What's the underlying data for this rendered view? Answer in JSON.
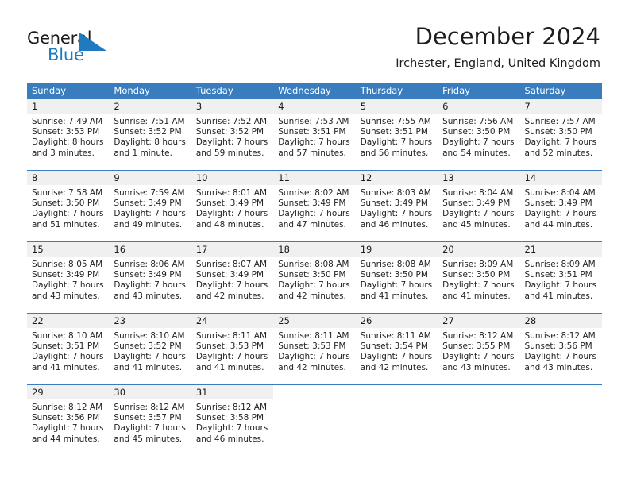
{
  "brand": {
    "name_part1": "General",
    "name_part2": "Blue",
    "triangle_color": "#1f7ac0"
  },
  "header": {
    "title": "December 2024",
    "location": "Irchester, England, United Kingdom"
  },
  "theme": {
    "header_blue": "#3a7dbf",
    "daynum_band": "#f0f0f0",
    "text": "#232323"
  },
  "calendar": {
    "weekday_headers": [
      "Sunday",
      "Monday",
      "Tuesday",
      "Wednesday",
      "Thursday",
      "Friday",
      "Saturday"
    ],
    "weeks": [
      [
        {
          "day": "1",
          "sunrise": "Sunrise: 7:49 AM",
          "sunset": "Sunset: 3:53 PM",
          "daylight1": "Daylight: 8 hours",
          "daylight2": "and 3 minutes."
        },
        {
          "day": "2",
          "sunrise": "Sunrise: 7:51 AM",
          "sunset": "Sunset: 3:52 PM",
          "daylight1": "Daylight: 8 hours",
          "daylight2": "and 1 minute."
        },
        {
          "day": "3",
          "sunrise": "Sunrise: 7:52 AM",
          "sunset": "Sunset: 3:52 PM",
          "daylight1": "Daylight: 7 hours",
          "daylight2": "and 59 minutes."
        },
        {
          "day": "4",
          "sunrise": "Sunrise: 7:53 AM",
          "sunset": "Sunset: 3:51 PM",
          "daylight1": "Daylight: 7 hours",
          "daylight2": "and 57 minutes."
        },
        {
          "day": "5",
          "sunrise": "Sunrise: 7:55 AM",
          "sunset": "Sunset: 3:51 PM",
          "daylight1": "Daylight: 7 hours",
          "daylight2": "and 56 minutes."
        },
        {
          "day": "6",
          "sunrise": "Sunrise: 7:56 AM",
          "sunset": "Sunset: 3:50 PM",
          "daylight1": "Daylight: 7 hours",
          "daylight2": "and 54 minutes."
        },
        {
          "day": "7",
          "sunrise": "Sunrise: 7:57 AM",
          "sunset": "Sunset: 3:50 PM",
          "daylight1": "Daylight: 7 hours",
          "daylight2": "and 52 minutes."
        }
      ],
      [
        {
          "day": "8",
          "sunrise": "Sunrise: 7:58 AM",
          "sunset": "Sunset: 3:50 PM",
          "daylight1": "Daylight: 7 hours",
          "daylight2": "and 51 minutes."
        },
        {
          "day": "9",
          "sunrise": "Sunrise: 7:59 AM",
          "sunset": "Sunset: 3:49 PM",
          "daylight1": "Daylight: 7 hours",
          "daylight2": "and 49 minutes."
        },
        {
          "day": "10",
          "sunrise": "Sunrise: 8:01 AM",
          "sunset": "Sunset: 3:49 PM",
          "daylight1": "Daylight: 7 hours",
          "daylight2": "and 48 minutes."
        },
        {
          "day": "11",
          "sunrise": "Sunrise: 8:02 AM",
          "sunset": "Sunset: 3:49 PM",
          "daylight1": "Daylight: 7 hours",
          "daylight2": "and 47 minutes."
        },
        {
          "day": "12",
          "sunrise": "Sunrise: 8:03 AM",
          "sunset": "Sunset: 3:49 PM",
          "daylight1": "Daylight: 7 hours",
          "daylight2": "and 46 minutes."
        },
        {
          "day": "13",
          "sunrise": "Sunrise: 8:04 AM",
          "sunset": "Sunset: 3:49 PM",
          "daylight1": "Daylight: 7 hours",
          "daylight2": "and 45 minutes."
        },
        {
          "day": "14",
          "sunrise": "Sunrise: 8:04 AM",
          "sunset": "Sunset: 3:49 PM",
          "daylight1": "Daylight: 7 hours",
          "daylight2": "and 44 minutes."
        }
      ],
      [
        {
          "day": "15",
          "sunrise": "Sunrise: 8:05 AM",
          "sunset": "Sunset: 3:49 PM",
          "daylight1": "Daylight: 7 hours",
          "daylight2": "and 43 minutes."
        },
        {
          "day": "16",
          "sunrise": "Sunrise: 8:06 AM",
          "sunset": "Sunset: 3:49 PM",
          "daylight1": "Daylight: 7 hours",
          "daylight2": "and 43 minutes."
        },
        {
          "day": "17",
          "sunrise": "Sunrise: 8:07 AM",
          "sunset": "Sunset: 3:49 PM",
          "daylight1": "Daylight: 7 hours",
          "daylight2": "and 42 minutes."
        },
        {
          "day": "18",
          "sunrise": "Sunrise: 8:08 AM",
          "sunset": "Sunset: 3:50 PM",
          "daylight1": "Daylight: 7 hours",
          "daylight2": "and 42 minutes."
        },
        {
          "day": "19",
          "sunrise": "Sunrise: 8:08 AM",
          "sunset": "Sunset: 3:50 PM",
          "daylight1": "Daylight: 7 hours",
          "daylight2": "and 41 minutes."
        },
        {
          "day": "20",
          "sunrise": "Sunrise: 8:09 AM",
          "sunset": "Sunset: 3:50 PM",
          "daylight1": "Daylight: 7 hours",
          "daylight2": "and 41 minutes."
        },
        {
          "day": "21",
          "sunrise": "Sunrise: 8:09 AM",
          "sunset": "Sunset: 3:51 PM",
          "daylight1": "Daylight: 7 hours",
          "daylight2": "and 41 minutes."
        }
      ],
      [
        {
          "day": "22",
          "sunrise": "Sunrise: 8:10 AM",
          "sunset": "Sunset: 3:51 PM",
          "daylight1": "Daylight: 7 hours",
          "daylight2": "and 41 minutes."
        },
        {
          "day": "23",
          "sunrise": "Sunrise: 8:10 AM",
          "sunset": "Sunset: 3:52 PM",
          "daylight1": "Daylight: 7 hours",
          "daylight2": "and 41 minutes."
        },
        {
          "day": "24",
          "sunrise": "Sunrise: 8:11 AM",
          "sunset": "Sunset: 3:53 PM",
          "daylight1": "Daylight: 7 hours",
          "daylight2": "and 41 minutes."
        },
        {
          "day": "25",
          "sunrise": "Sunrise: 8:11 AM",
          "sunset": "Sunset: 3:53 PM",
          "daylight1": "Daylight: 7 hours",
          "daylight2": "and 42 minutes."
        },
        {
          "day": "26",
          "sunrise": "Sunrise: 8:11 AM",
          "sunset": "Sunset: 3:54 PM",
          "daylight1": "Daylight: 7 hours",
          "daylight2": "and 42 minutes."
        },
        {
          "day": "27",
          "sunrise": "Sunrise: 8:12 AM",
          "sunset": "Sunset: 3:55 PM",
          "daylight1": "Daylight: 7 hours",
          "daylight2": "and 43 minutes."
        },
        {
          "day": "28",
          "sunrise": "Sunrise: 8:12 AM",
          "sunset": "Sunset: 3:56 PM",
          "daylight1": "Daylight: 7 hours",
          "daylight2": "and 43 minutes."
        }
      ],
      [
        {
          "day": "29",
          "sunrise": "Sunrise: 8:12 AM",
          "sunset": "Sunset: 3:56 PM",
          "daylight1": "Daylight: 7 hours",
          "daylight2": "and 44 minutes."
        },
        {
          "day": "30",
          "sunrise": "Sunrise: 8:12 AM",
          "sunset": "Sunset: 3:57 PM",
          "daylight1": "Daylight: 7 hours",
          "daylight2": "and 45 minutes."
        },
        {
          "day": "31",
          "sunrise": "Sunrise: 8:12 AM",
          "sunset": "Sunset: 3:58 PM",
          "daylight1": "Daylight: 7 hours",
          "daylight2": "and 46 minutes."
        },
        {
          "day": "",
          "sunrise": "",
          "sunset": "",
          "daylight1": "",
          "daylight2": ""
        },
        {
          "day": "",
          "sunrise": "",
          "sunset": "",
          "daylight1": "",
          "daylight2": ""
        },
        {
          "day": "",
          "sunrise": "",
          "sunset": "",
          "daylight1": "",
          "daylight2": ""
        },
        {
          "day": "",
          "sunrise": "",
          "sunset": "",
          "daylight1": "",
          "daylight2": ""
        }
      ]
    ]
  }
}
